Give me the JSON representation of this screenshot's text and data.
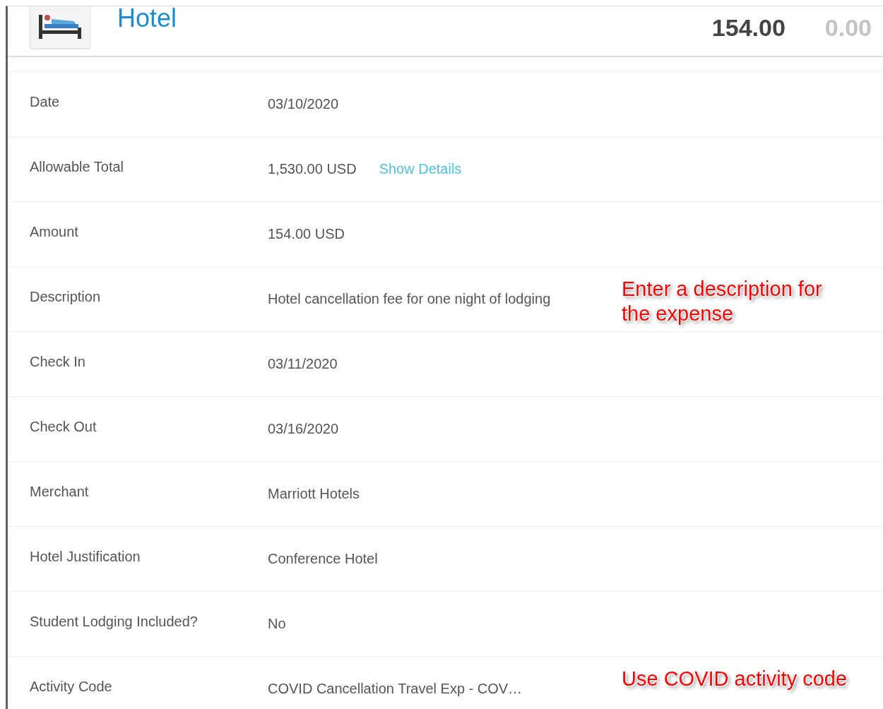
{
  "header": {
    "title": "Hotel",
    "amount": "154.00",
    "secondary_amount": "0.00"
  },
  "rows": [
    {
      "label": "Date",
      "value": "03/10/2020"
    },
    {
      "label": "Allowable Total",
      "value": "1,530.00 USD",
      "link": "Show Details"
    },
    {
      "label": "Amount",
      "value": "154.00 USD"
    },
    {
      "label": "Description",
      "value": "Hotel cancellation fee for one night of lodging",
      "annotation": "Enter a description for the expense"
    },
    {
      "label": "Check In",
      "value": "03/11/2020"
    },
    {
      "label": "Check Out",
      "value": "03/16/2020"
    },
    {
      "label": "Merchant",
      "value": "Marriott Hotels"
    },
    {
      "label": "Hotel Justification",
      "value": "Conference Hotel"
    },
    {
      "label": "Student Lodging Included?",
      "value": "No"
    },
    {
      "label": "Activity Code",
      "value": "COVID Cancellation Travel Exp - COV…",
      "annotation": "Use COVID activity code"
    }
  ]
}
